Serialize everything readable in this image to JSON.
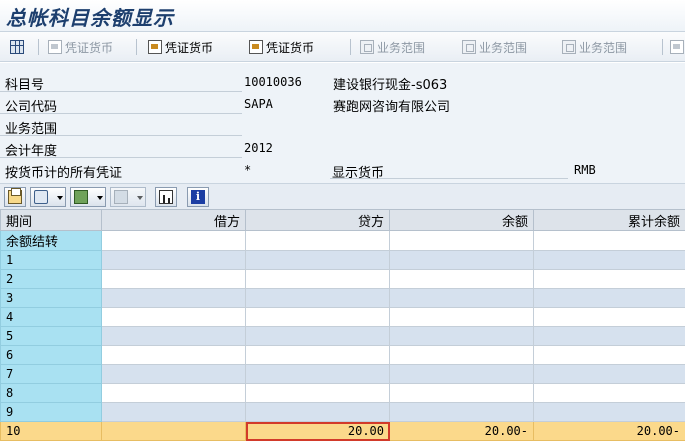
{
  "title": "总帐科目余额显示",
  "toolbar": {
    "buttons": [
      {
        "label": "",
        "icon": "grid-icon",
        "enabled": true
      },
      {
        "label": "凭证货币",
        "icon": "document-icon",
        "enabled": false
      },
      {
        "label": "凭证货币",
        "icon": "document-icon",
        "enabled": true
      },
      {
        "label": "凭证货币",
        "icon": "document-org-icon",
        "enabled": true
      },
      {
        "label": "业务范围",
        "icon": "org-icon",
        "enabled": false
      },
      {
        "label": "业务范围",
        "icon": "org-icon",
        "enabled": false
      },
      {
        "label": "业务范围",
        "icon": "org-icon",
        "enabled": false
      }
    ]
  },
  "info": {
    "account_label": "科目号",
    "account_value": "10010036",
    "account_desc": "建设银行现金-s063",
    "company_label": "公司代码",
    "company_value": "SAPA",
    "company_desc": "赛跑网咨询有限公司",
    "business_area_label": "业务范围",
    "fiscal_year_label": "会计年度",
    "fiscal_year_value": "2012",
    "docs_label": "按货币计的所有凭证",
    "docs_value": "*",
    "display_currency_label": "显示货币",
    "display_currency_value": "RMB"
  },
  "table": {
    "columns": [
      "期间",
      "借方",
      "贷方",
      "余额",
      "累计余额"
    ],
    "rows": [
      {
        "period": "余额结转",
        "debit": "",
        "credit": "",
        "balance": "",
        "cumulative": ""
      },
      {
        "period": "1",
        "debit": "",
        "credit": "",
        "balance": "",
        "cumulative": ""
      },
      {
        "period": "2",
        "debit": "",
        "credit": "",
        "balance": "",
        "cumulative": ""
      },
      {
        "period": "3",
        "debit": "",
        "credit": "",
        "balance": "",
        "cumulative": ""
      },
      {
        "period": "4",
        "debit": "",
        "credit": "",
        "balance": "",
        "cumulative": ""
      },
      {
        "period": "5",
        "debit": "",
        "credit": "",
        "balance": "",
        "cumulative": ""
      },
      {
        "period": "6",
        "debit": "",
        "credit": "",
        "balance": "",
        "cumulative": ""
      },
      {
        "period": "7",
        "debit": "",
        "credit": "",
        "balance": "",
        "cumulative": ""
      },
      {
        "period": "8",
        "debit": "",
        "credit": "",
        "balance": "",
        "cumulative": ""
      },
      {
        "period": "9",
        "debit": "",
        "credit": "",
        "balance": "",
        "cumulative": ""
      },
      {
        "period": "10",
        "debit": "",
        "credit": "20.00",
        "balance": "20.00-",
        "cumulative": "20.00-"
      }
    ]
  },
  "colors": {
    "title": "#1d3f6e",
    "period_column": "#a9e1f2",
    "selected_row": "#fbd98b",
    "alt_row": "#d6e1ee"
  }
}
